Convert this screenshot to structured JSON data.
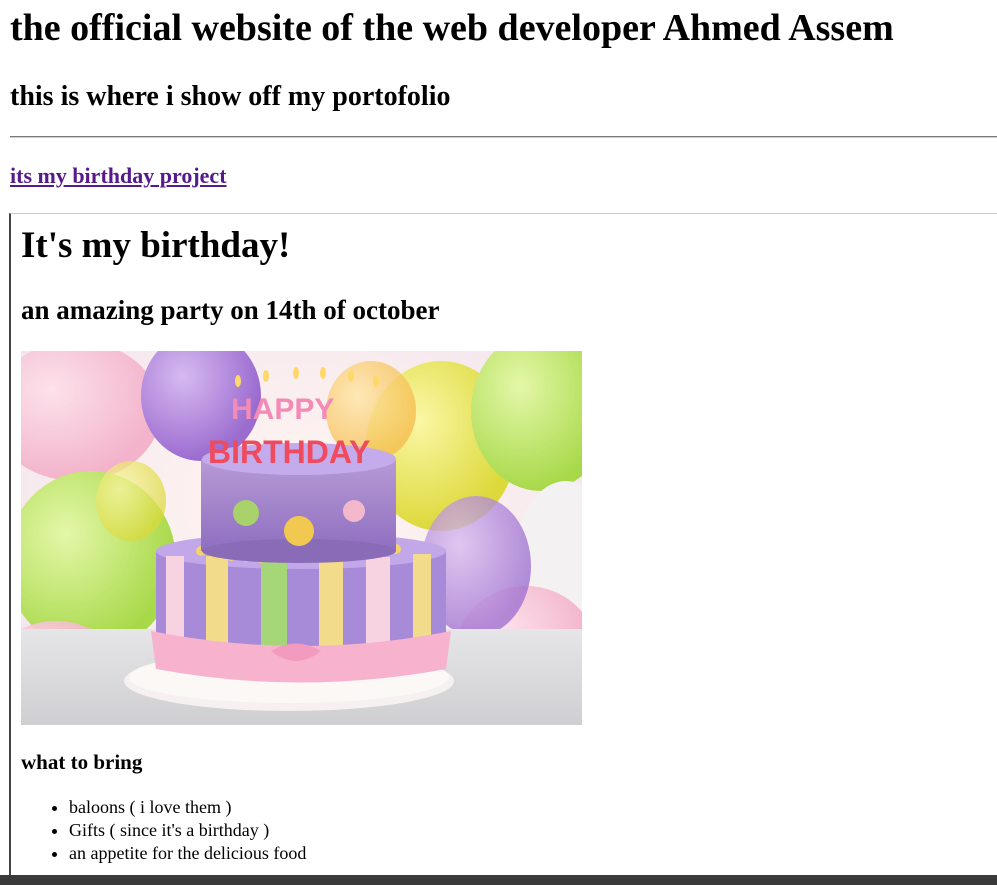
{
  "site": {
    "title": "the official website of the web developer Ahmed Assem",
    "subtitle": "this is where i show off my portofolio",
    "project_link": "its my birthday project"
  },
  "birthday": {
    "heading": "It's my birthday!",
    "subheading": "an amazing party on 14th of october",
    "image": {
      "cake_text_top": "HAPPY",
      "cake_text_bottom": "BIRTHDAY"
    },
    "bring_heading": "what to bring",
    "bring_items": [
      "baloons ( i love them )",
      "Gifts ( since it's a birthday )",
      "an appetite for the delicious food"
    ]
  },
  "colors": {
    "link_visited": "#551a8b",
    "text": "#000000",
    "background": "#ffffff"
  }
}
